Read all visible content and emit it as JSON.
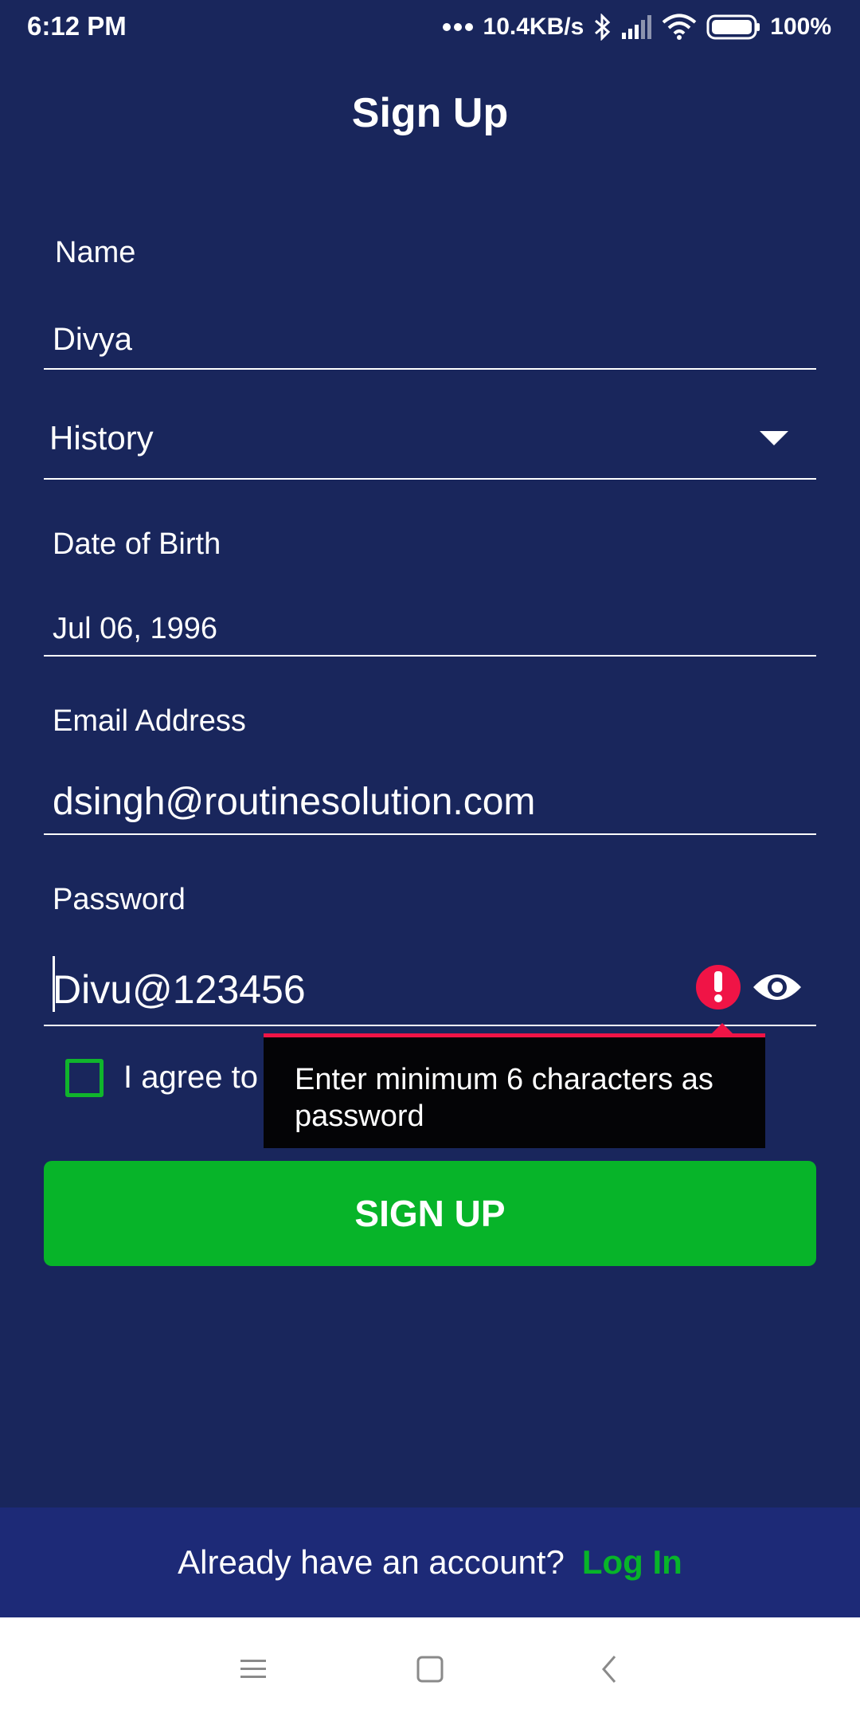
{
  "status_bar": {
    "time": "6:12 PM",
    "speed": "10.4KB/s",
    "battery": "100%",
    "icons": [
      "more-dots-icon",
      "bluetooth-icon",
      "signal-icon",
      "wifi-icon",
      "battery-icon"
    ]
  },
  "header": {
    "title": "Sign Up"
  },
  "form": {
    "name_label": "Name",
    "name_value": "Divya",
    "subject_value": "History",
    "dob_label": "Date of Birth",
    "dob_value": "Jul 06, 1996",
    "email_label": "Email Address",
    "email_value": "dsingh@routinesolution.com",
    "password_label": "Password",
    "password_value": "Divu@123456",
    "agree_text": "I agree to th",
    "error_tooltip": "Enter minimum 6 characters as password",
    "signup_button": "SIGN UP"
  },
  "footer": {
    "prompt": "Already have an account?",
    "login_link": "Log In"
  },
  "colors": {
    "background": "#19265C",
    "footer": "#1D2A77",
    "accent_green": "#07B429",
    "error_red": "#F01446"
  }
}
